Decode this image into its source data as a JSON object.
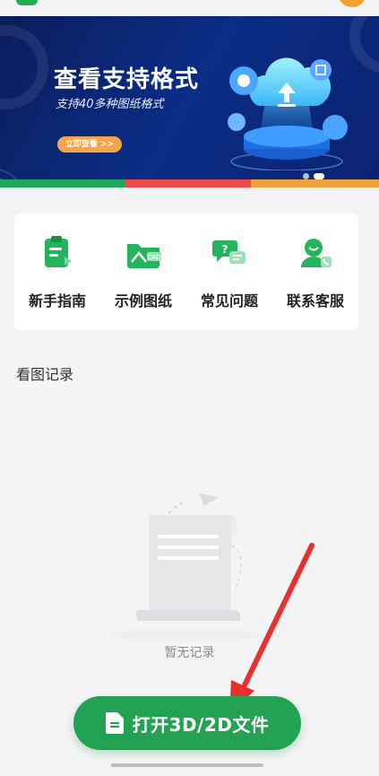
{
  "banner": {
    "title": "查看支持格式",
    "subtitle": "支持40多种图纸格式",
    "cta_label": "立即查看 >>",
    "stripe_colors": [
      "#1ea758",
      "#ef4b4b",
      "#f0a23a"
    ]
  },
  "quick_menu": {
    "items": [
      {
        "label": "新手指南",
        "icon": "guide-clipboard-icon"
      },
      {
        "label": "示例图纸",
        "icon": "cad-folder-icon"
      },
      {
        "label": "常见问题",
        "icon": "faq-chat-icon"
      },
      {
        "label": "联系客服",
        "icon": "customer-service-icon"
      }
    ]
  },
  "history": {
    "title": "看图记录",
    "empty_text": "暂无记录"
  },
  "open_button": {
    "label": "打开3D/2D文件",
    "color": "#23a254"
  },
  "colors": {
    "brand_green": "#23a254",
    "banner_bg": "#0b2d86",
    "annotation_red": "#e8312f"
  }
}
